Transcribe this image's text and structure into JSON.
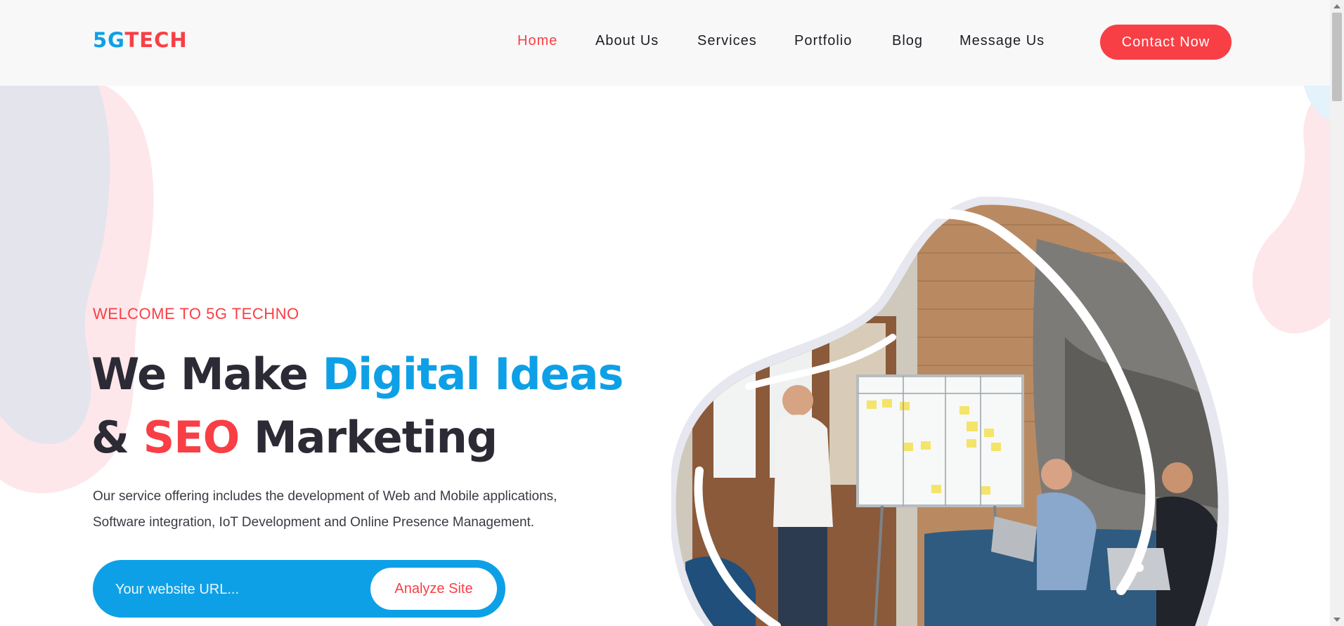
{
  "brand": {
    "logo_part1": "5G",
    "logo_part2": "TECH",
    "colors": {
      "blue": "#0ea0e6",
      "red": "#f83f45",
      "dark": "#2b2a35"
    }
  },
  "nav": {
    "items": [
      {
        "label": "Home",
        "active": true
      },
      {
        "label": "About Us"
      },
      {
        "label": "Services"
      },
      {
        "label": "Portfolio"
      },
      {
        "label": "Blog"
      },
      {
        "label": "Message Us"
      }
    ],
    "cta_label": "Contact Now"
  },
  "hero": {
    "eyebrow": "WELCOME TO 5G TECHNO",
    "headline_line1_a": "We Make ",
    "headline_line1_b": "Digital Ideas",
    "headline_line2_a": "& ",
    "headline_line2_b": "SEO",
    "headline_line2_c": " Marketing",
    "description_line1": "Our service offering includes the development of Web and Mobile applications,",
    "description_line2": "Software integration, IoT Development and Online Presence Management.",
    "search_placeholder": "Your website URL...",
    "search_button": "Analyze Site"
  },
  "icons": [
    "scroll-up-arrow-icon",
    "scroll-down-arrow-icon"
  ]
}
